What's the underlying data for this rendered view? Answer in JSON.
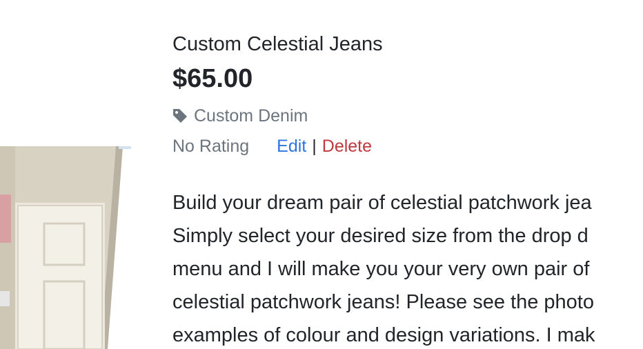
{
  "product": {
    "title": "Custom Celestial Jeans",
    "price": "$65.00",
    "category": "Custom Denim",
    "rating": "No Rating",
    "edit_label": "Edit",
    "separator": "|",
    "delete_label": "Delete",
    "description_lines": [
      "Build your dream pair of celestial patchwork jea",
      "Simply select your desired size from the drop d",
      "menu and I will make you your very own pair of",
      "celestial patchwork jeans! Please see the photo",
      "examples of colour and design variations. I mak"
    ]
  },
  "icons": {
    "category": "tag-icon"
  },
  "colors": {
    "text": "#212529",
    "muted": "#6c757d",
    "edit": "#2d74e0",
    "delete": "#c0393e"
  }
}
